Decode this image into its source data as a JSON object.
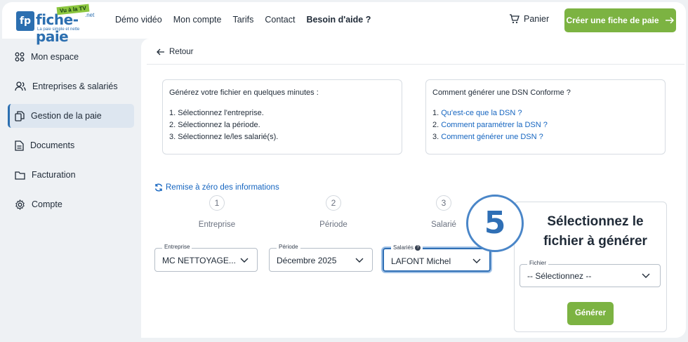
{
  "logo": {
    "brand": "fiche-paie",
    "badge": "Vu à la TV",
    "suffix": ".net",
    "tagline": "La paie simple et nette"
  },
  "nav": [
    "Démo vidéo",
    "Mon compte",
    "Tarifs",
    "Contact",
    "Besoin d'aide ?"
  ],
  "header": {
    "cart_label": "Panier",
    "cta_label": "Créer une fiche de paie"
  },
  "sidebar": {
    "items": [
      {
        "label": "Mon espace",
        "icon": "dashboard-icon"
      },
      {
        "label": "Entreprises & salariés",
        "icon": "users-icon"
      },
      {
        "label": "Gestion de la paie",
        "icon": "copy-icon",
        "active": true
      },
      {
        "label": "Documents",
        "icon": "document-icon"
      },
      {
        "label": "Facturation",
        "icon": "folder-icon"
      },
      {
        "label": "Compte",
        "icon": "gear-icon"
      }
    ]
  },
  "main": {
    "back_label": "Retour",
    "info_left": {
      "title": "Générez votre fichier en quelques minutes :",
      "steps": [
        "1. Sélectionnez l'entreprise.",
        "2. Sélectionnez la période.",
        "3. Sélectionnez le/les salarié(s)."
      ]
    },
    "info_right": {
      "title": "Comment générer une DSN Conforme ?",
      "links": [
        {
          "num": "1.",
          "text": "Qu'est-ce que la DSN ?"
        },
        {
          "num": "2.",
          "text": "Comment paramétrer la DSN ?"
        },
        {
          "num": "3.",
          "text": "Comment générer une DSN ?"
        }
      ]
    },
    "reset_label": "Remise à zéro des informations",
    "steps": [
      {
        "num": "1",
        "label": "Entreprise"
      },
      {
        "num": "2",
        "label": "Période"
      },
      {
        "num": "3",
        "label": "Salarié"
      }
    ],
    "fields": {
      "entreprise": {
        "label": "Entreprise",
        "value": "MC NETTOYAGE..."
      },
      "periode": {
        "label": "Période",
        "value": "Décembre 2025"
      },
      "salaries": {
        "label": "Salariés",
        "value": "LAFONT Michel"
      }
    },
    "step_badge": "5",
    "panel": {
      "title": "Sélectionnez le fichier à générer",
      "field_label": "Fichier",
      "field_value": "-- Sélectionnez --",
      "button_label": "Générer"
    }
  },
  "colors": {
    "accent_green": "#7cb342",
    "brand_blue": "#2c6fb0",
    "link_blue": "#1565c0"
  }
}
